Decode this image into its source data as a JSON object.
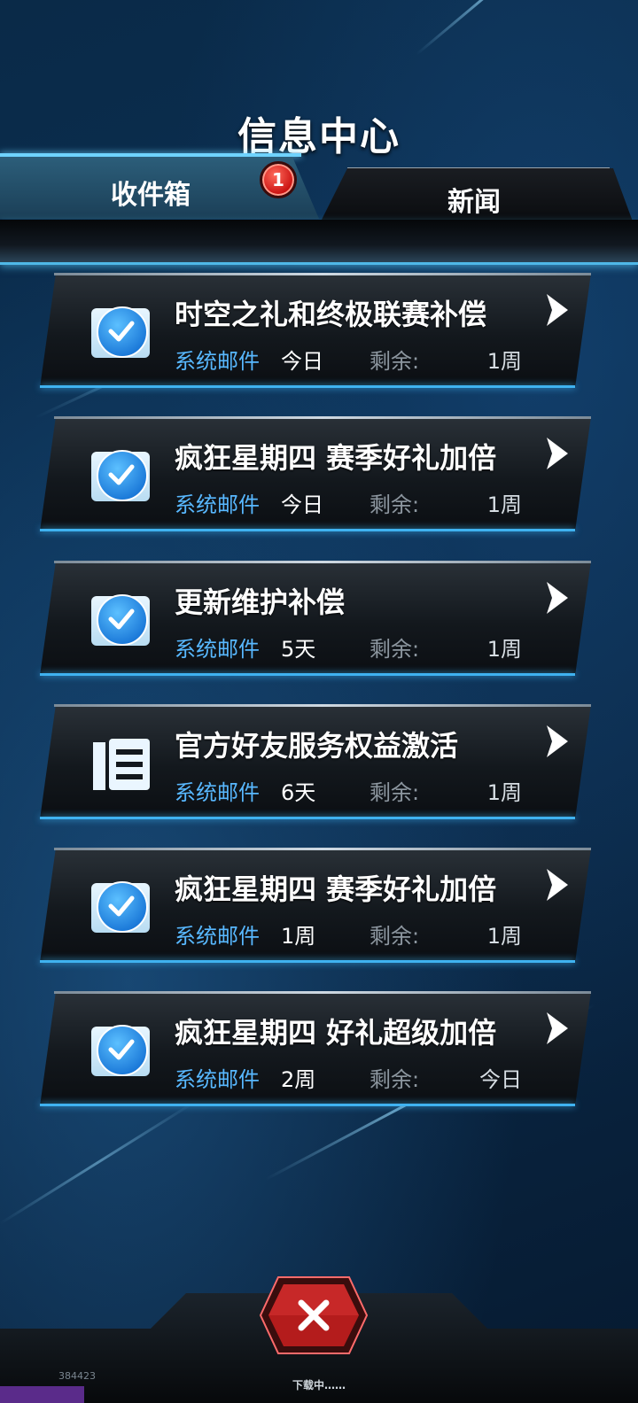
{
  "title": "信息中心",
  "tabs": {
    "inbox": "收件箱",
    "news": "新闻"
  },
  "badge_count": "1",
  "remaining_label": "剩余:",
  "mails": [
    {
      "subject": "时空之礼和终极联赛补偿",
      "type": "系统邮件",
      "age": "今日",
      "remaining": "1周",
      "icon": "check-icon"
    },
    {
      "subject": "疯狂星期四 赛季好礼加倍",
      "type": "系统邮件",
      "age": "今日",
      "remaining": "1周",
      "icon": "check-icon"
    },
    {
      "subject": "更新维护补偿",
      "type": "系统邮件",
      "age": "5天",
      "remaining": "1周",
      "icon": "check-icon"
    },
    {
      "subject": "官方好友服务权益激活",
      "type": "系统邮件",
      "age": "6天",
      "remaining": "1周",
      "icon": "notice-icon"
    },
    {
      "subject": "疯狂星期四 赛季好礼加倍",
      "type": "系统邮件",
      "age": "1周",
      "remaining": "1周",
      "icon": "check-icon"
    },
    {
      "subject": "疯狂星期四 好礼超级加倍",
      "type": "系统邮件",
      "age": "2周",
      "remaining": "今日",
      "icon": "check-icon"
    }
  ],
  "footer": {
    "download_status": "下载中……",
    "version": "384423"
  },
  "colors": {
    "accent": "#3fb2f0",
    "mail_type": "#58b8ff",
    "badge": "#d01414",
    "close": "#c01c1c"
  }
}
